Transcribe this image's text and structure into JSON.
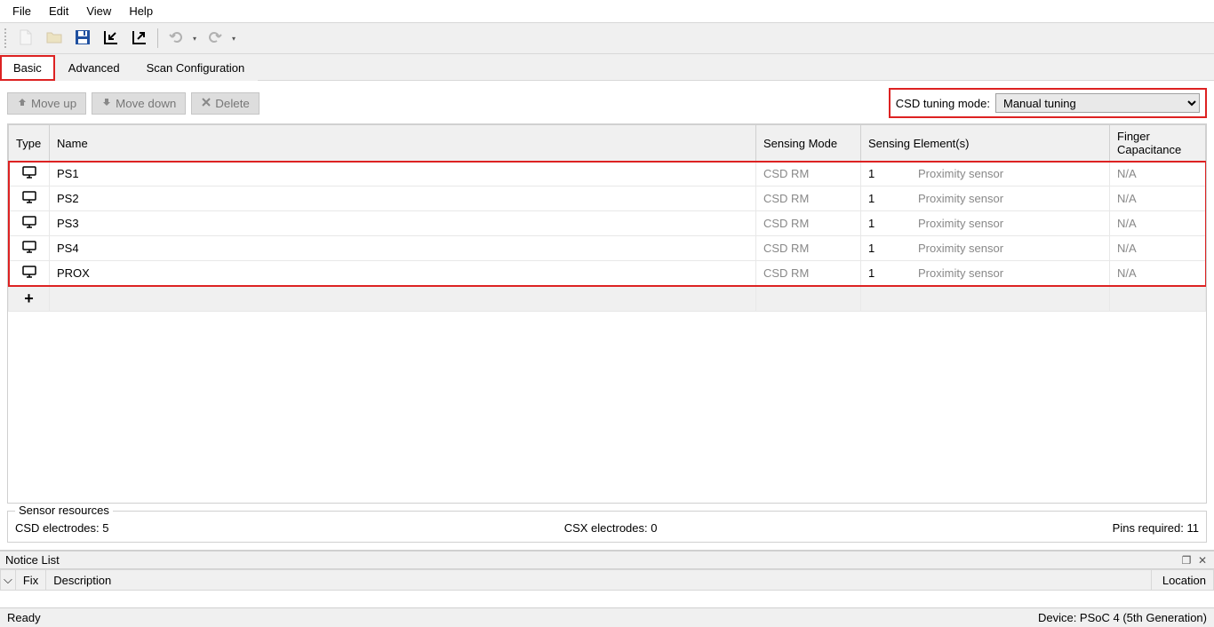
{
  "menu": [
    "File",
    "Edit",
    "View",
    "Help"
  ],
  "tabs": [
    {
      "label": "Basic",
      "active": true,
      "highlighted": true
    },
    {
      "label": "Advanced",
      "active": false,
      "highlighted": false
    },
    {
      "label": "Scan Configuration",
      "active": false,
      "highlighted": false
    }
  ],
  "actions": {
    "move_up": "Move up",
    "move_down": "Move down",
    "delete": "Delete"
  },
  "tuning": {
    "label": "CSD tuning mode:",
    "selected": "Manual tuning"
  },
  "columns": {
    "type": "Type",
    "name": "Name",
    "mode": "Sensing Mode",
    "elements": "Sensing Element(s)",
    "cap": "Finger Capacitance"
  },
  "rows": [
    {
      "name": "PS1",
      "mode": "CSD RM",
      "elem_n": "1",
      "elem_t": "Proximity sensor",
      "cap": "N/A"
    },
    {
      "name": "PS2",
      "mode": "CSD RM",
      "elem_n": "1",
      "elem_t": "Proximity sensor",
      "cap": "N/A"
    },
    {
      "name": "PS3",
      "mode": "CSD RM",
      "elem_n": "1",
      "elem_t": "Proximity sensor",
      "cap": "N/A"
    },
    {
      "name": "PS4",
      "mode": "CSD RM",
      "elem_n": "1",
      "elem_t": "Proximity sensor",
      "cap": "N/A"
    },
    {
      "name": "PROX",
      "mode": "CSD RM",
      "elem_n": "1",
      "elem_t": "Proximity sensor",
      "cap": "N/A"
    }
  ],
  "resources": {
    "title": "Sensor resources",
    "csd": "CSD electrodes:  5",
    "csx": "CSX electrodes:  0",
    "pins": "Pins required:  11"
  },
  "notice": {
    "title": "Notice List",
    "cols": {
      "fix": "Fix",
      "desc": "Description",
      "loc": "Location"
    }
  },
  "status": {
    "ready": "Ready",
    "device": "Device: PSoC 4 (5th Generation)"
  }
}
